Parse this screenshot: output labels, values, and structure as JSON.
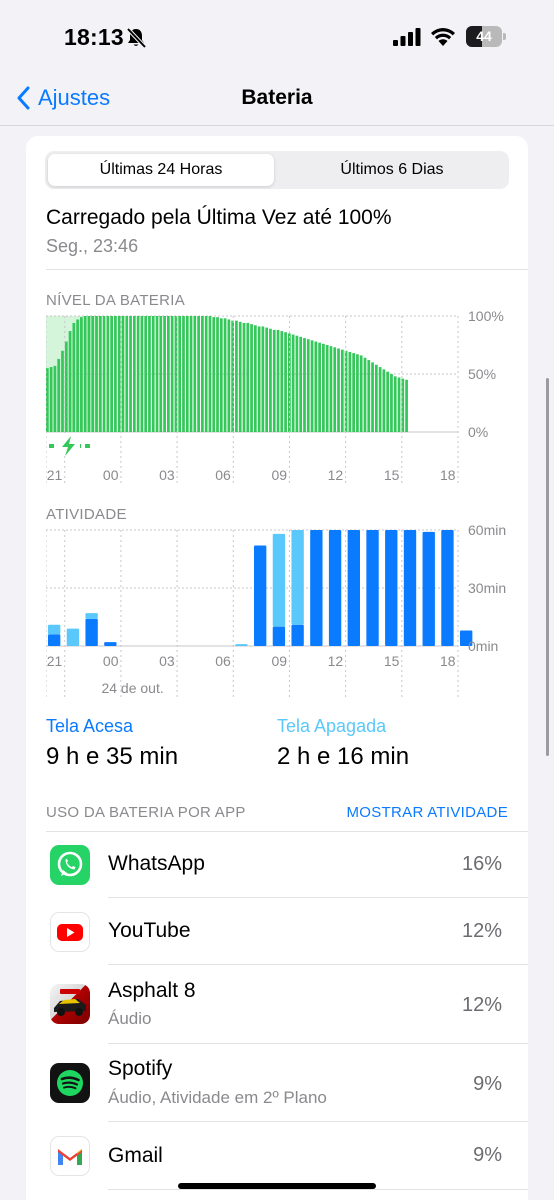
{
  "status": {
    "time": "18:13",
    "battery_level": "44",
    "battery_fraction": 0.44,
    "icons": [
      "bell-slash-icon",
      "cellular-signal-icon",
      "wifi-icon",
      "battery-icon"
    ]
  },
  "nav": {
    "back_label": "Ajustes",
    "title": "Bateria"
  },
  "segments": [
    {
      "label": "Últimas 24 Horas",
      "selected": true
    },
    {
      "label": "Últimos 6 Dias",
      "selected": false
    }
  ],
  "last_charge": {
    "title": "Carregado pela Última Vez até 100%",
    "subtitle": "Seg., 23:46"
  },
  "colors": {
    "accent": "#0a7aff",
    "battery_green": "#34c759",
    "charging_green": "#d4f5d9",
    "screen_on": "#0a7aff",
    "screen_off": "#5ac8fa",
    "gridline": "#c7c7cc"
  },
  "battery_chart": {
    "section_label": "NÍVEL DA BATERIA",
    "y_ticks": [
      "100%",
      "50%",
      "0%"
    ],
    "x_ticks": [
      "21",
      "00",
      "03",
      "06",
      "09",
      "12",
      "15",
      "18"
    ],
    "chart_data": {
      "type": "bar",
      "y_unit": "%",
      "ylim": [
        0,
        100
      ],
      "x_range_hours": "20:00 – 18:13",
      "charging_segment": "20:00 – 23:00",
      "values": [
        55,
        56,
        57,
        63,
        70,
        78,
        87,
        94,
        97,
        99,
        100,
        100,
        100,
        100,
        100,
        100,
        100,
        100,
        100,
        100,
        100,
        100,
        100,
        100,
        100,
        100,
        100,
        100,
        100,
        100,
        100,
        100,
        100,
        100,
        100,
        100,
        100,
        100,
        100,
        100,
        100,
        100,
        100,
        100,
        99,
        99,
        98,
        98,
        97,
        96,
        96,
        95,
        94,
        94,
        93,
        92,
        91,
        91,
        90,
        89,
        88,
        88,
        87,
        86,
        85,
        84,
        83,
        82,
        81,
        80,
        79,
        78,
        77,
        76,
        75,
        74,
        73,
        72,
        71,
        70,
        69,
        68,
        67,
        66,
        64,
        62,
        60,
        58,
        56,
        54,
        52,
        50,
        48,
        47,
        46,
        45
      ]
    }
  },
  "activity_chart": {
    "section_label": "ATIVIDADE",
    "y_ticks": [
      "60min",
      "30min",
      "0min"
    ],
    "x_ticks": [
      "21",
      "00",
      "03",
      "06",
      "09",
      "12",
      "15",
      "18"
    ],
    "date_label": "24 de out.",
    "chart_data": {
      "type": "bar",
      "y_unit": "min",
      "ylim": [
        0,
        60
      ],
      "categories": [
        "20h",
        "21h",
        "22h",
        "23h",
        "00h",
        "01h",
        "02h",
        "03h",
        "04h",
        "05h",
        "06h",
        "07h",
        "08h",
        "09h",
        "10h",
        "11h",
        "12h",
        "13h",
        "14h",
        "15h",
        "16h",
        "17h",
        "18h"
      ],
      "series": [
        {
          "name": "Tela Acesa",
          "values": [
            6,
            0,
            14,
            2,
            0,
            0,
            0,
            0,
            0,
            0,
            0,
            52,
            10,
            11,
            60,
            60,
            60,
            60,
            60,
            60,
            59,
            60,
            8
          ]
        },
        {
          "name": "Tela Apagada",
          "values": [
            5,
            9,
            3,
            0,
            0,
            0,
            0,
            0,
            0,
            0,
            1,
            0,
            48,
            49,
            0,
            0,
            0,
            0,
            0,
            0,
            0,
            0,
            0
          ]
        }
      ]
    }
  },
  "screen_totals": {
    "on_label": "Tela Acesa",
    "on_value": "9 h e 35 min",
    "off_label": "Tela Apagada",
    "off_value": "2 h e 16 min"
  },
  "usage": {
    "title": "USO DA BATERIA POR APP",
    "show_activity": "MOSTRAR ATIVIDADE",
    "apps": [
      {
        "name": "WhatsApp",
        "subtitle": "",
        "percent": "16%",
        "icon": "whatsapp-icon"
      },
      {
        "name": "YouTube",
        "subtitle": "",
        "percent": "12%",
        "icon": "youtube-icon"
      },
      {
        "name": "Asphalt 8",
        "subtitle": "Áudio",
        "percent": "12%",
        "icon": "asphalt-icon"
      },
      {
        "name": "Spotify",
        "subtitle": "Áudio, Atividade em 2º Plano",
        "percent": "9%",
        "icon": "spotify-icon"
      },
      {
        "name": "Gmail",
        "subtitle": "",
        "percent": "9%",
        "icon": "gmail-icon"
      }
    ]
  }
}
